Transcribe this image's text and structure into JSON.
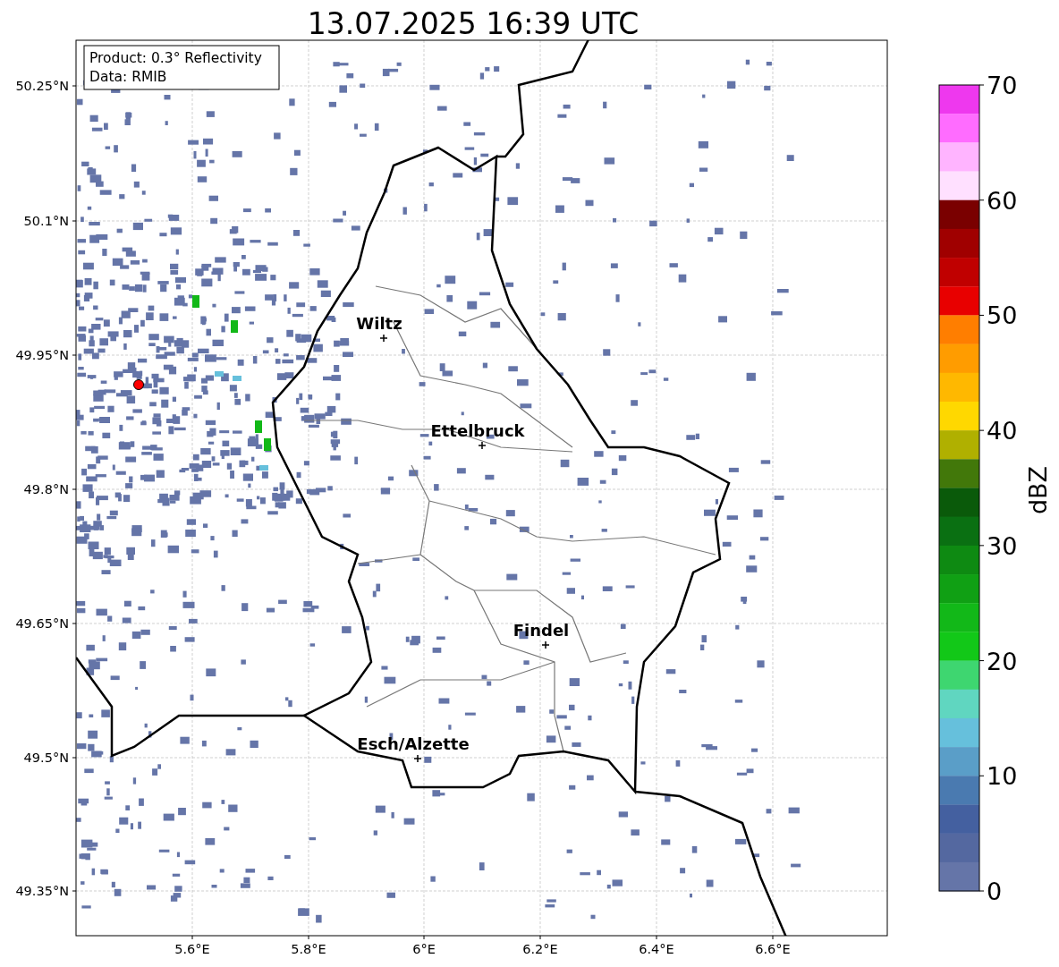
{
  "title": "13.07.2025 16:39 UTC",
  "legend": [
    "Product: 0.3° Reflectivity",
    "Data: RMIB"
  ],
  "latitude_ticks": [
    "50.25°N",
    "50.1°N",
    "49.95°N",
    "49.8°N",
    "49.65°N",
    "49.5°N",
    "49.35°N"
  ],
  "longitude_ticks": [
    "5.6°E",
    "5.8°E",
    "6°E",
    "6.2°E",
    "6.4°E",
    "6.6°E"
  ],
  "places": [
    {
      "name": "Wiltz"
    },
    {
      "name": "Ettelbruck"
    },
    {
      "name": "Findel"
    },
    {
      "name": "Esch/Alzette"
    }
  ],
  "colorbar": {
    "label": "dBZ",
    "ticks": [
      "70",
      "60",
      "50",
      "40",
      "30",
      "20",
      "10",
      "0"
    ],
    "bins": [
      {
        "color": "#ee38ee"
      },
      {
        "color": "#ff6cff"
      },
      {
        "color": "#ffb4ff"
      },
      {
        "color": "#ffe0ff"
      },
      {
        "color": "#7a0000"
      },
      {
        "color": "#a00000"
      },
      {
        "color": "#c00000"
      },
      {
        "color": "#e80000"
      },
      {
        "color": "#ff7e00"
      },
      {
        "color": "#ff9c00"
      },
      {
        "color": "#ffb800"
      },
      {
        "color": "#ffd800"
      },
      {
        "color": "#b0b000"
      },
      {
        "color": "#42780a"
      },
      {
        "color": "#0a5a0a"
      },
      {
        "color": "#0a7012"
      },
      {
        "color": "#0e8a12"
      },
      {
        "color": "#10a014"
      },
      {
        "color": "#12b818"
      },
      {
        "color": "#12c818"
      },
      {
        "color": "#3ed670"
      },
      {
        "color": "#60d6c0"
      },
      {
        "color": "#66c0dc"
      },
      {
        "color": "#5a9ec8"
      },
      {
        "color": "#4a7ab0"
      },
      {
        "color": "#4460a0"
      },
      {
        "color": "#5468a0"
      },
      {
        "color": "#6575a8"
      }
    ]
  }
}
